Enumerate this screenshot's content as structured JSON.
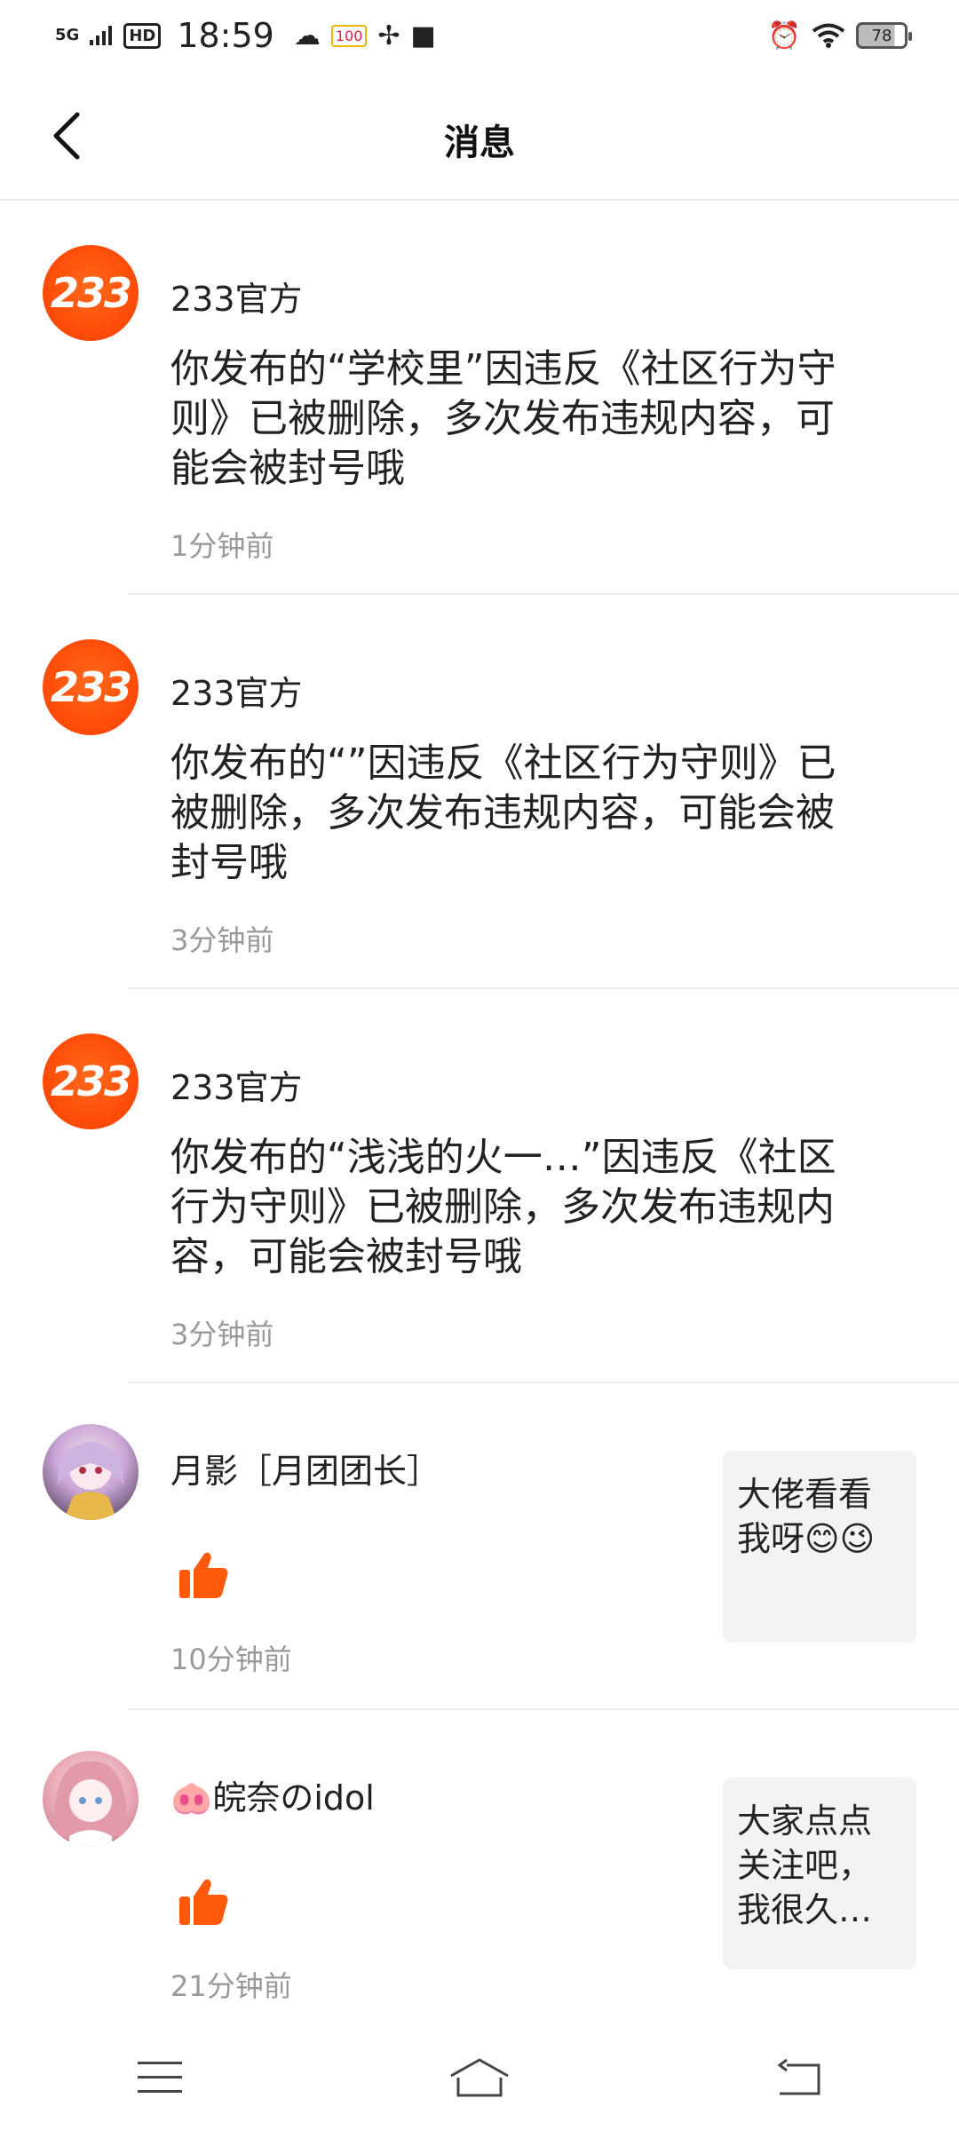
{
  "status_bar": {
    "network": "5G",
    "hd": "HD",
    "time": "18:59",
    "badge": "100",
    "battery": "78"
  },
  "header": {
    "title": "消息"
  },
  "messages": [
    {
      "sender": "233官方",
      "body": "你发布的“学校里”因违反《社区行为守则》已被删除，多次发布违规内容，可能会被封号哦",
      "time": "1分钟前",
      "avatar_text": "233"
    },
    {
      "sender": "233官方",
      "body": "你发布的“”因违反《社区行为守则》已被删除，多次发布违规内容，可能会被封号哦",
      "time": "3分钟前",
      "avatar_text": "233"
    },
    {
      "sender": "233官方",
      "body": "你发布的“浅浅的火一…”因违反《社区行为守则》已被删除，多次发布违规内容，可能会被封号哦",
      "time": "3分钟前",
      "avatar_text": "233"
    },
    {
      "sender": "月影［月团团长］",
      "time": "10分钟前",
      "thumb_text": "大佬看看我呀😊😉"
    },
    {
      "sender": "🐽皖奈のidol",
      "time": "21分钟前",
      "thumb_text": "大家点点关注吧，我很久…"
    }
  ],
  "colors": {
    "accent": "#ff5a0a",
    "time_gray": "#999999",
    "divider": "#ececec"
  }
}
